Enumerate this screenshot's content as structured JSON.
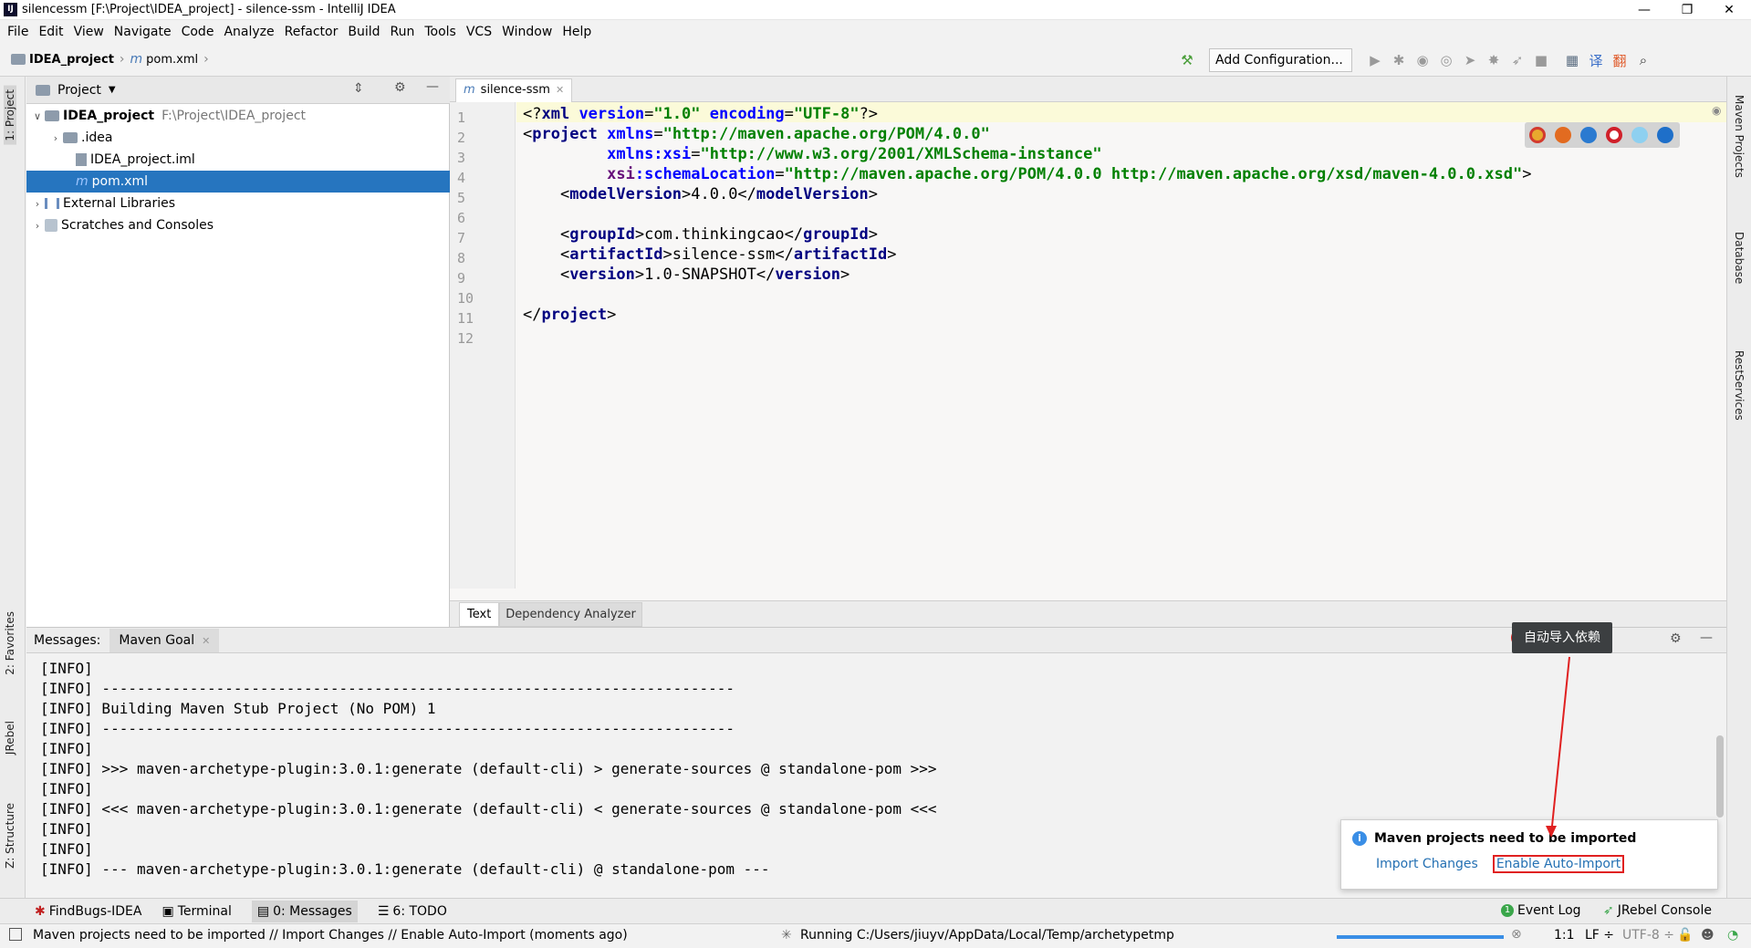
{
  "titlebar": {
    "title": "silencessm [F:\\Project\\IDEA_project] - silence-ssm - IntelliJ IDEA",
    "minimize": "—",
    "restore": "❐",
    "close": "✕"
  },
  "menu": [
    "File",
    "Edit",
    "View",
    "Navigate",
    "Code",
    "Analyze",
    "Refactor",
    "Build",
    "Run",
    "Tools",
    "VCS",
    "Window",
    "Help"
  ],
  "breadcrumb": {
    "project": "IDEA_project",
    "file": "pom.xml"
  },
  "toolbar": {
    "add_configuration": "Add Configuration..."
  },
  "left_stripe": {
    "project": "1: Project",
    "favorites": "2: Favorites",
    "jrebel": "JRebel",
    "structure": "Z: Structure"
  },
  "right_stripe": {
    "maven": "Maven Projects",
    "database": "Database",
    "rest": "RestServices"
  },
  "project_panel": {
    "header": "Project",
    "tree": [
      {
        "label": "IDEA_project",
        "path": "F:\\Project\\IDEA_project"
      },
      {
        "label": ".idea"
      },
      {
        "label": "IDEA_project.iml"
      },
      {
        "label": "pom.xml"
      },
      {
        "label": "External Libraries"
      },
      {
        "label": "Scratches and Consoles"
      }
    ]
  },
  "editor": {
    "tab": "silence-ssm",
    "line_numbers": [
      "1",
      "2",
      "3",
      "4",
      "5",
      "6",
      "7",
      "8",
      "9",
      "10",
      "11",
      "12"
    ],
    "bottom_tabs": {
      "text": "Text",
      "dependency": "Dependency Analyzer"
    }
  },
  "code": {
    "l1a": "<?",
    "l1b": "xml ",
    "l1c": "version",
    "l1d": "=",
    "l1e": "\"1.0\"",
    "l1f": " encoding",
    "l1g": "=",
    "l1h": "\"UTF-8\"",
    "l1i": "?>",
    "l2a": "<",
    "l2b": "project ",
    "l2c": "xmlns",
    "l2d": "=",
    "l2e": "\"http://maven.apache.org/POM/4.0.0\"",
    "l3a": "         ",
    "l3b": "xmlns:xsi",
    "l3c": "=",
    "l3d": "\"http://www.w3.org/2001/XMLSchema-instance\"",
    "l4a": "         ",
    "l4b": "xsi",
    "l4c": ":schemaLocation",
    "l4d": "=",
    "l4e": "\"http://maven.apache.org/POM/4.0.0 http://maven.apache.org/xsd/maven-4.0.0.xsd\"",
    "l4f": ">",
    "l5a": "    <",
    "l5b": "modelVersion",
    "l5c": ">4.0.0</",
    "l5d": "modelVersion",
    "l5e": ">",
    "l7a": "    <",
    "l7b": "groupId",
    "l7c": ">com.thinkingcao</",
    "l7d": "groupId",
    "l7e": ">",
    "l8a": "    <",
    "l8b": "artifactId",
    "l8c": ">silence-ssm</",
    "l8d": "artifactId",
    "l8e": ">",
    "l9a": "    <",
    "l9b": "version",
    "l9c": ">1.0-SNAPSHOT</",
    "l9d": "version",
    "l9e": ">",
    "l12a": "</",
    "l12b": "project",
    "l12c": ">"
  },
  "messages": {
    "label": "Messages:",
    "tab": "Maven Goal",
    "log": [
      "[INFO]",
      "[INFO] ------------------------------------------------------------------------",
      "[INFO] Building Maven Stub Project (No POM) 1",
      "[INFO] ------------------------------------------------------------------------",
      "[INFO]",
      "[INFO] >>> maven-archetype-plugin:3.0.1:generate (default-cli) > generate-sources @ standalone-pom >>>",
      "[INFO]",
      "[INFO] <<< maven-archetype-plugin:3.0.1:generate (default-cli) < generate-sources @ standalone-pom <<<",
      "[INFO]",
      "[INFO]",
      "[INFO] --- maven-archetype-plugin:3.0.1:generate (default-cli) @ standalone-pom ---"
    ]
  },
  "annotation": {
    "badge": "1",
    "tooltip": "自动导入依赖"
  },
  "notification": {
    "title": "Maven projects need to be imported",
    "import_changes": "Import Changes",
    "enable_auto_import": "Enable Auto-Import"
  },
  "tool_windows": {
    "findbugs": "FindBugs-IDEA",
    "terminal": "Terminal",
    "messages": "0: Messages",
    "todo": "6: TODO",
    "event_log": "Event Log",
    "jrebel_console": "JRebel Console"
  },
  "status": {
    "message": "Maven projects need to be imported // Import Changes // Enable Auto-Import (moments ago)",
    "running": "Running C:/Users/jiuyv/AppData/Local/Temp/archetypetmp",
    "position": "1:1",
    "line_sep": "LF ÷",
    "encoding": "UTF-8 ÷"
  }
}
